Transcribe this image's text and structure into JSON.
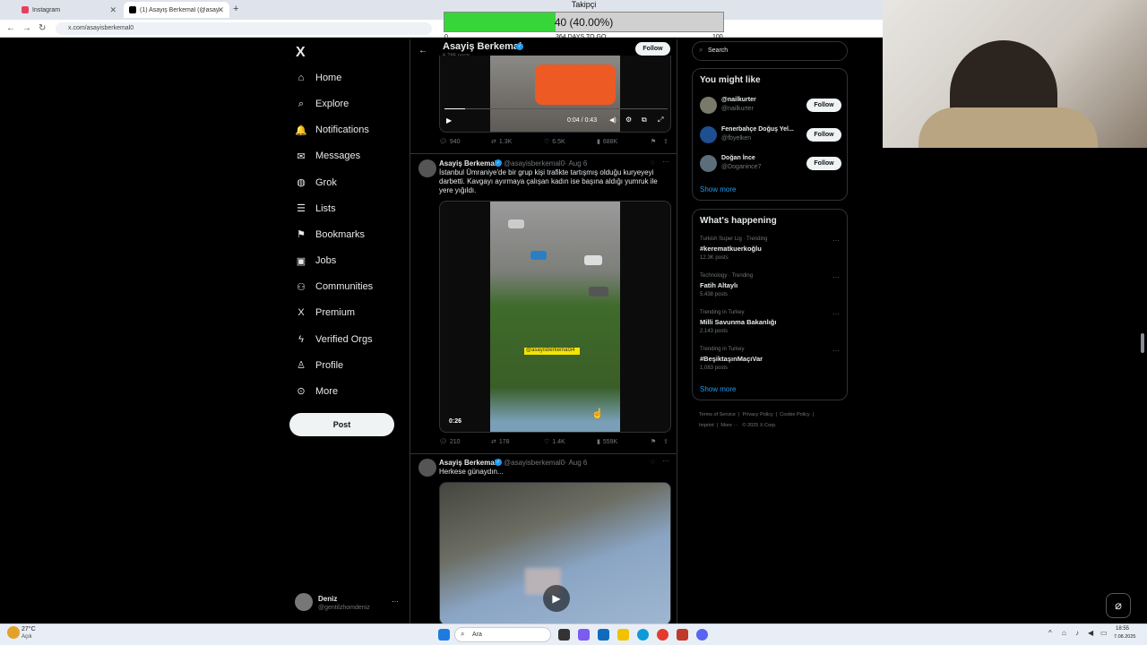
{
  "browser": {
    "tabs": [
      {
        "title": "Instagram",
        "close": "✕"
      },
      {
        "title": "(1) Asayiş Berkemal (@asayisbe",
        "close": "✕"
      }
    ],
    "new_tab": "+",
    "url": "x.com/asayisberkemal0"
  },
  "overlay": {
    "title": "Takipçi",
    "progress_text": "40 (40.00%)",
    "progress_fraction": 0.4,
    "min": "0",
    "caption": "364 DAYS TO GO",
    "max": "100",
    "fill_color": "#38d53a"
  },
  "nav": {
    "logo": "X",
    "items": [
      {
        "label": "Home",
        "icon": "home-icon",
        "glyph": "⌂"
      },
      {
        "label": "Explore",
        "icon": "search-icon",
        "glyph": "⌕"
      },
      {
        "label": "Notifications",
        "icon": "bell-icon",
        "glyph": "🔔"
      },
      {
        "label": "Messages",
        "icon": "mail-icon",
        "glyph": "✉"
      },
      {
        "label": "Grok",
        "icon": "grok-icon",
        "glyph": "◍"
      },
      {
        "label": "Lists",
        "icon": "list-icon",
        "glyph": "☰"
      },
      {
        "label": "Bookmarks",
        "icon": "bookmark-icon",
        "glyph": "⚑"
      },
      {
        "label": "Jobs",
        "icon": "briefcase-icon",
        "glyph": "▣"
      },
      {
        "label": "Communities",
        "icon": "people-icon",
        "glyph": "⚇"
      },
      {
        "label": "Premium",
        "icon": "x-icon",
        "glyph": "X"
      },
      {
        "label": "Verified Orgs",
        "icon": "bolt-icon",
        "glyph": "ϟ"
      },
      {
        "label": "Profile",
        "icon": "person-icon",
        "glyph": "♙"
      },
      {
        "label": "More",
        "icon": "more-circle-icon",
        "glyph": "⊙"
      }
    ],
    "post_label": "Post",
    "user": {
      "name": "Deniz",
      "handle": "@gentilzhomdeniz",
      "more": "···"
    }
  },
  "profile_header": {
    "name": "Asayiş Berkemal",
    "posts": "6,785 posts",
    "follow": "Follow",
    "back": "←"
  },
  "tweets": [
    {
      "video_time": "0:04 / 0:43",
      "stats": {
        "replies": "940",
        "reposts": "1.3K",
        "likes": "6.5K",
        "views": "688K"
      }
    },
    {
      "name": "Asayiş Berkemal",
      "handle": "@asayisberkemal0",
      "date": "· Aug 6",
      "text": "İstanbul Ümraniye'de bir grup kişi trafikte tartışmış olduğu kuryeyeyi darbetti. Kavgayı ayırmaya çalışan kadın ise başına aldığı yumruk ile yere yığıldı.",
      "watermark": "@asayisberkemal34",
      "duration": "0:26",
      "stats": {
        "replies": "210",
        "reposts": "178",
        "likes": "1.4K",
        "views": "559K"
      }
    },
    {
      "name": "Asayiş Berkemal",
      "handle": "@asayisberkemal0",
      "date": "· Aug 6",
      "text": "Herkese günaydın..."
    }
  ],
  "search": {
    "placeholder": "Search"
  },
  "you_might_like": {
    "title": "You might like",
    "users": [
      {
        "name": "@nailkurter",
        "handle": "@nailkurter",
        "follow": "Follow"
      },
      {
        "name": "Fenerbahçe Doğuş Yel...",
        "handle": "@fbyelken",
        "follow": "Follow"
      },
      {
        "name": "Doğan İnce",
        "handle": "@Doganince7",
        "follow": "Follow"
      }
    ],
    "show_more": "Show more"
  },
  "whats_happening": {
    "title": "What's happening",
    "trends": [
      {
        "category": "Turkish Super Lig · Trending",
        "name": "#kerematkuerkoğlu",
        "count": "12.3K posts"
      },
      {
        "category": "Technology · Trending",
        "name": "Fatih Altaylı",
        "count": "5,438 posts"
      },
      {
        "category": "Trending in Turkey",
        "name": "Milli Savunma Bakanlığı",
        "count": "2,143 posts"
      },
      {
        "category": "Trending in Turkey",
        "name": "#BeşiktaşınMaçıVar",
        "count": "1,083 posts"
      }
    ],
    "show_more": "Show more"
  },
  "footer": {
    "links": [
      "Terms of Service",
      "Privacy Policy",
      "Cookie Policy",
      "Imprint",
      "More ···",
      "© 2025 X Corp."
    ]
  },
  "taskbar": {
    "weather": "27°C",
    "weather_sub": "Açık",
    "search": "Ara",
    "time": "18:55",
    "date": "7.08.2025"
  }
}
